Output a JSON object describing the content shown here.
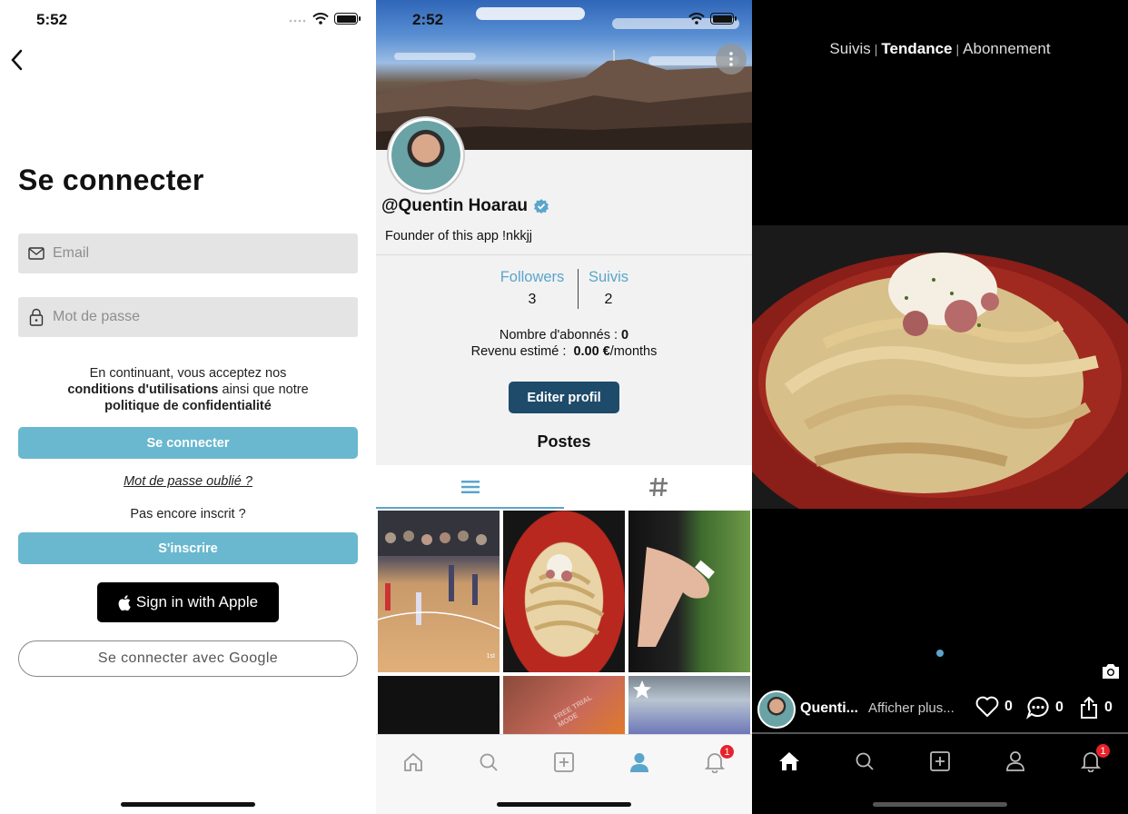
{
  "login": {
    "status_time": "5:52",
    "title": "Se connecter",
    "email_placeholder": "Email",
    "password_placeholder": "Mot de passe",
    "terms_text_1": "En continuant, vous acceptez nos",
    "terms_link_1": "conditions d'utilisations",
    "terms_text_2": "ainsi que notre",
    "terms_link_2": "politique de confidentialité",
    "login_button": "Se connecter",
    "forgot_password": "Mot de passe oublié ?",
    "not_registered": "Pas encore inscrit ?",
    "signup_button": "S'inscrire",
    "apple_button": "Sign in with Apple",
    "google_button": "Se connecter avec Google"
  },
  "profile": {
    "status_time": "2:52",
    "username": "@Quentin Hoarau",
    "bio": "Founder of this app !nkkjj",
    "followers_label": "Followers",
    "followers_count": "3",
    "following_label": "Suivis",
    "following_count": "2",
    "subscribers_label": "Nombre d'abonnés :",
    "subscribers_value": "0",
    "revenue_label": "Revenu estimé :",
    "revenue_value": "0.00 €",
    "revenue_unit": "/months",
    "edit_button": "Editer profil",
    "posts_title": "Postes",
    "notification_badge": "1",
    "grid_labels": [
      "1st",
      "FREE TRIAL MODE"
    ]
  },
  "feed": {
    "tabs": [
      "Suivis",
      "Tendance",
      "Abonnement"
    ],
    "active_tab": "Tendance",
    "username": "Quenti...",
    "show_more": "Afficher plus...",
    "likes": "0",
    "comments": "0",
    "shares": "0",
    "notification_badge": "1"
  },
  "colors": {
    "accent_teal": "#69b8cf",
    "link_blue": "#5aa5cc",
    "edit_navy": "#1e4b6a",
    "badge_red": "#e8222c"
  },
  "icons": [
    "back-chevron-icon",
    "mail-icon",
    "lock-icon",
    "apple-icon",
    "more-icon",
    "verified-icon",
    "list-icon",
    "hashtag-icon",
    "home-icon",
    "search-icon",
    "add-icon",
    "profile-icon",
    "bell-icon",
    "camera-icon",
    "heart-icon",
    "comment-icon",
    "share-icon",
    "wifi-icon",
    "battery-icon"
  ]
}
